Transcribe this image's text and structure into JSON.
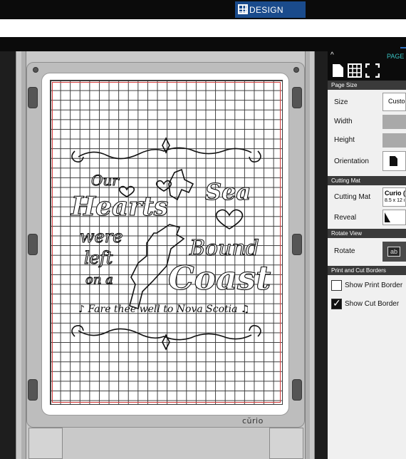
{
  "top": {
    "design_tab": "DESIGN"
  },
  "panel": {
    "header": "PAGE S",
    "icons": [
      "page-icon",
      "grid-icon",
      "crop-icon"
    ],
    "sections": {
      "page_size": "Page Size",
      "cutting_mat": "Cutting Mat",
      "rotate_view": "Rotate View",
      "print_cut": "Print and Cut Borders"
    },
    "labels": {
      "size": "Size",
      "width": "Width",
      "height": "Height",
      "orientation": "Orientation",
      "cutting_mat": "Cutting Mat",
      "reveal": "Reveal",
      "rotate": "Rotate"
    },
    "size_value": "Custo",
    "mat_value_line1": "Curio (c",
    "mat_value_line2": "8.5 x 12 i",
    "rotate_icon_text": "ab",
    "show_print_border": {
      "label": "Show Print Border",
      "checked": false
    },
    "show_cut_border": {
      "label": "Show Cut Border",
      "checked": true
    }
  },
  "mat": {
    "brand": "cŭrio"
  },
  "design": {
    "left_words": [
      "Our",
      "Hearts",
      "were",
      "left",
      "on a"
    ],
    "right_words": [
      "Sea",
      "Bound",
      "Coast"
    ],
    "footer": "♪ Fare thee well to Nova Scotia ♫"
  },
  "colors": {
    "accent": "#1a4b8c",
    "panel_header_text": "#39c2c2",
    "cut_border": "#d43a3a"
  }
}
